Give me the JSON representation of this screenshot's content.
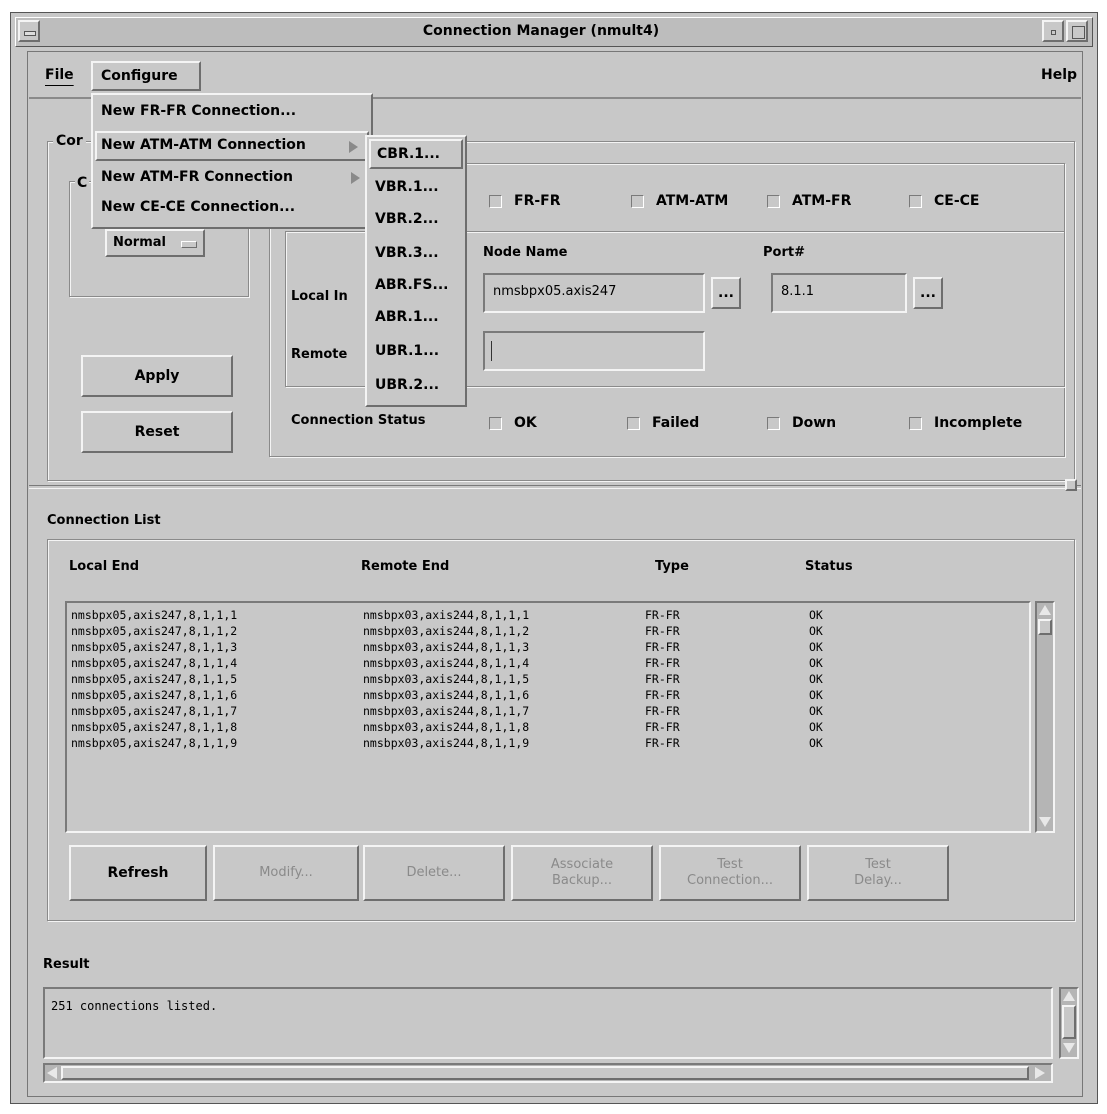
{
  "window": {
    "title": "Connection Manager (nmult4)"
  },
  "menubar": {
    "file": "File",
    "configure": "Configure",
    "help": "Help"
  },
  "configure_menu": {
    "items": [
      "New FR-FR Connection...",
      "New ATM-ATM Connection",
      "New ATM-FR Connection",
      "New CE-CE Connection..."
    ]
  },
  "atm_submenu": {
    "items": [
      "CBR.1...",
      "VBR.1...",
      "VBR.2...",
      "VBR.3...",
      "ABR.FS...",
      "ABR.1...",
      "UBR.1...",
      "UBR.2..."
    ]
  },
  "config": {
    "group_label_partial": "Cor",
    "inner_group_label_partial": "C",
    "mode_value": "Normal",
    "apply": "Apply",
    "reset": "Reset",
    "types": [
      "FR-FR",
      "ATM-ATM",
      "ATM-FR",
      "CE-CE"
    ],
    "node_name_label": "Node Name",
    "port_label": "Port#",
    "local_label_partial": "Local In",
    "remote_label_partial": "Remote",
    "local_node_value": "nmsbpx05.axis247",
    "local_port_value": "8.1.1",
    "remote_node_value": "",
    "browse": "...",
    "status_label": "Connection Status",
    "statuses": [
      "OK",
      "Failed",
      "Down",
      "Incomplete"
    ]
  },
  "connection_list": {
    "title": "Connection List",
    "columns": [
      "Local End",
      "Remote End",
      "Type",
      "Status"
    ],
    "rows": [
      [
        "nmsbpx05,axis247,8,1,1,1",
        "nmsbpx03,axis244,8,1,1,1",
        "FR-FR",
        "OK"
      ],
      [
        "nmsbpx05,axis247,8,1,1,2",
        "nmsbpx03,axis244,8,1,1,2",
        "FR-FR",
        "OK"
      ],
      [
        "nmsbpx05,axis247,8,1,1,3",
        "nmsbpx03,axis244,8,1,1,3",
        "FR-FR",
        "OK"
      ],
      [
        "nmsbpx05,axis247,8,1,1,4",
        "nmsbpx03,axis244,8,1,1,4",
        "FR-FR",
        "OK"
      ],
      [
        "nmsbpx05,axis247,8,1,1,5",
        "nmsbpx03,axis244,8,1,1,5",
        "FR-FR",
        "OK"
      ],
      [
        "nmsbpx05,axis247,8,1,1,6",
        "nmsbpx03,axis244,8,1,1,6",
        "FR-FR",
        "OK"
      ],
      [
        "nmsbpx05,axis247,8,1,1,7",
        "nmsbpx03,axis244,8,1,1,7",
        "FR-FR",
        "OK"
      ],
      [
        "nmsbpx05,axis247,8,1,1,8",
        "nmsbpx03,axis244,8,1,1,8",
        "FR-FR",
        "OK"
      ],
      [
        "nmsbpx05,axis247,8,1,1,9",
        "nmsbpx03,axis244,8,1,1,9",
        "FR-FR",
        "OK"
      ]
    ],
    "buttons": {
      "refresh": "Refresh",
      "modify": "Modify...",
      "delete": "Delete...",
      "associate_1": "Associate",
      "associate_2": "Backup...",
      "test_conn_1": "Test",
      "test_conn_2": "Connection...",
      "test_delay_1": "Test",
      "test_delay_2": "Delay..."
    }
  },
  "result": {
    "title": "Result",
    "text": "251 connections listed."
  }
}
